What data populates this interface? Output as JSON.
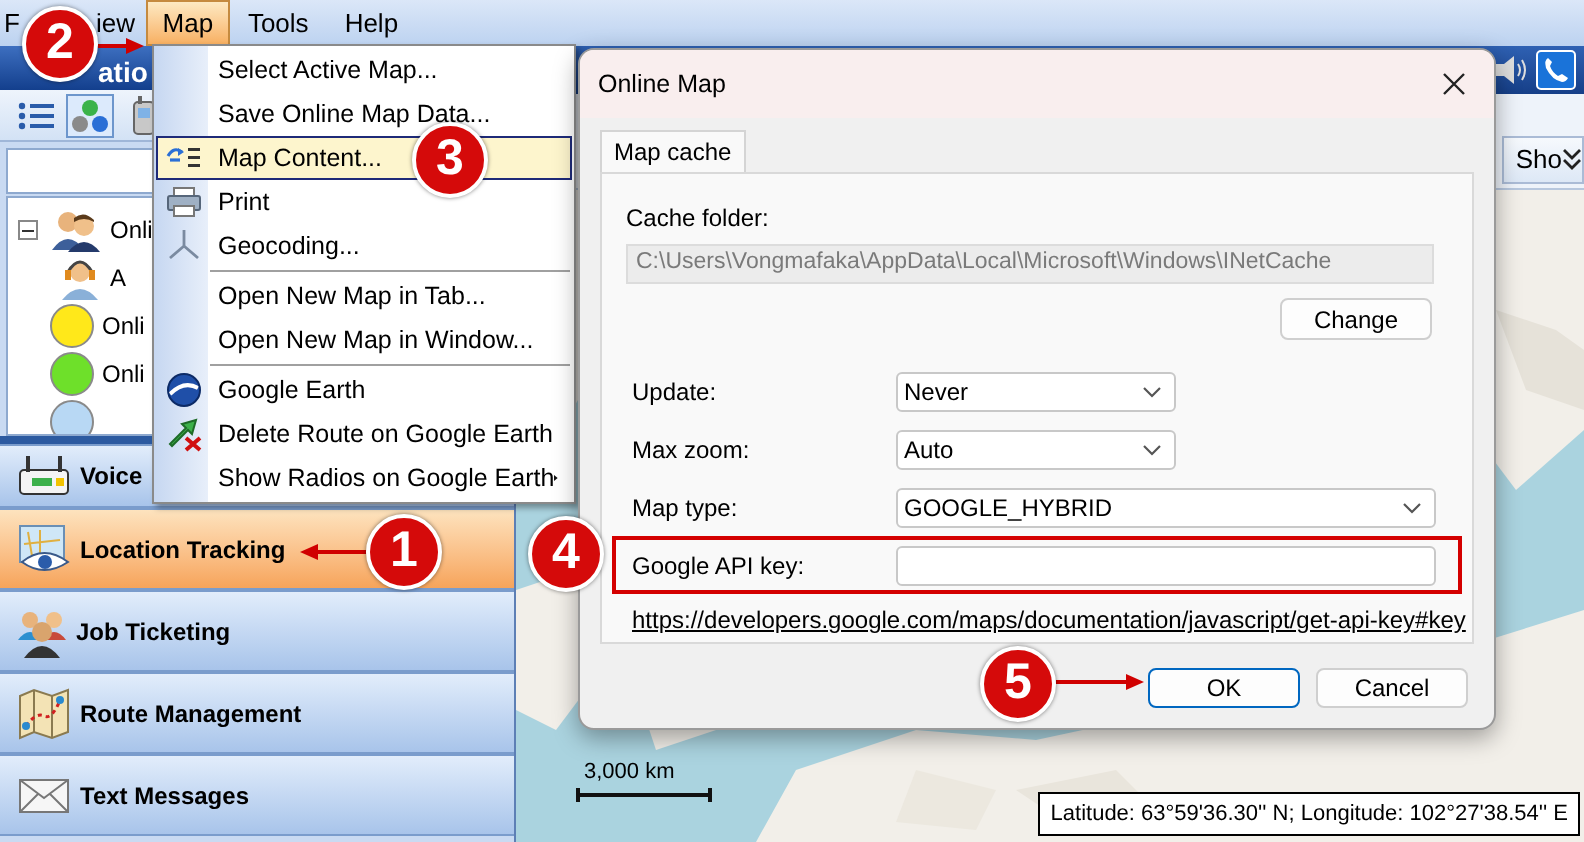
{
  "menubar": [
    {
      "label": "F",
      "selected": false
    },
    {
      "label": "iew",
      "selected": false
    },
    {
      "label": "Map",
      "selected": true
    },
    {
      "label": "Tools",
      "selected": false
    },
    {
      "label": "Help",
      "selected": false
    }
  ],
  "left_panel": {
    "title": "atio",
    "toolbar": [
      {
        "selected": false
      },
      {
        "selected": true
      },
      {
        "selected": false
      }
    ],
    "tree": [
      {
        "kind": "group",
        "label": "Onli",
        "expanded": true,
        "children": [
          {
            "kind": "dispatcher",
            "label": "A"
          }
        ]
      },
      {
        "kind": "status",
        "label": "Onli",
        "color": "#ffe81a"
      },
      {
        "kind": "status",
        "label": "Onli",
        "color": "#6ee02a"
      },
      {
        "kind": "status",
        "color": "#b8d8f4"
      }
    ],
    "nav": [
      {
        "label": "Voice",
        "selected": false
      },
      {
        "label": "Location Tracking",
        "selected": true
      },
      {
        "label": "Job Ticketing",
        "selected": false
      },
      {
        "label": "Route Management",
        "selected": false
      },
      {
        "label": "Text Messages",
        "selected": false
      }
    ]
  },
  "map_menu": [
    {
      "kind": "item",
      "label": "Select Active Map...",
      "selected": false
    },
    {
      "kind": "item",
      "label": "Save Online Map Data...",
      "selected": false
    },
    {
      "kind": "item",
      "label": "Map Content...",
      "selected": true
    },
    {
      "kind": "item",
      "label": "Print",
      "selected": false
    },
    {
      "kind": "item",
      "label": "Geocoding...",
      "selected": false
    },
    {
      "kind": "separator"
    },
    {
      "kind": "item",
      "label": "Open New Map in Tab...",
      "selected": false
    },
    {
      "kind": "item",
      "label": "Open New Map in Window...",
      "selected": false
    },
    {
      "kind": "separator"
    },
    {
      "kind": "item",
      "label": "Google Earth",
      "selected": false
    },
    {
      "kind": "item",
      "label": "Delete Route on Google Earth",
      "selected": false
    },
    {
      "kind": "item",
      "label": "Show Radios on Google Earth",
      "selected": false,
      "submenu": true
    }
  ],
  "map": {
    "show_button": "Sho",
    "scale": "3,000 km",
    "coordinates": "Latitude: 63°59'36.30'' N; Longitude: 102°27'38.54'' E"
  },
  "dialog": {
    "title": "Online Map",
    "tabs": [
      {
        "label": "Map cache",
        "selected": true
      }
    ],
    "cache_folder": {
      "label": "Cache folder:",
      "value": "C:\\Users\\Vongmafaka\\AppData\\Local\\Microsoft\\Windows\\INetCache",
      "disabled": true
    },
    "change_button": "Change",
    "settings": [
      {
        "kind": "select",
        "label": "Update:",
        "value": "Never",
        "highlighted": false
      },
      {
        "kind": "select",
        "label": "Max zoom:",
        "value": "Auto",
        "highlighted": false
      },
      {
        "kind": "select",
        "label": "Map type:",
        "value": "GOOGLE_HYBRID",
        "highlighted": false
      },
      {
        "kind": "text",
        "label": "Google API key:",
        "highlighted": true
      }
    ],
    "link": "https://developers.google.com/maps/documentation/javascript/get-api-key#key",
    "buttons": [
      {
        "label": "OK",
        "default": true
      },
      {
        "label": "Cancel",
        "default": false
      }
    ]
  },
  "callouts": [
    {
      "number": "2",
      "arrow": true
    },
    {
      "number": "3",
      "arrow": false
    },
    {
      "number": "1",
      "arrow": true
    },
    {
      "number": "4",
      "arrow": false
    },
    {
      "number": "5",
      "arrow": true
    }
  ]
}
